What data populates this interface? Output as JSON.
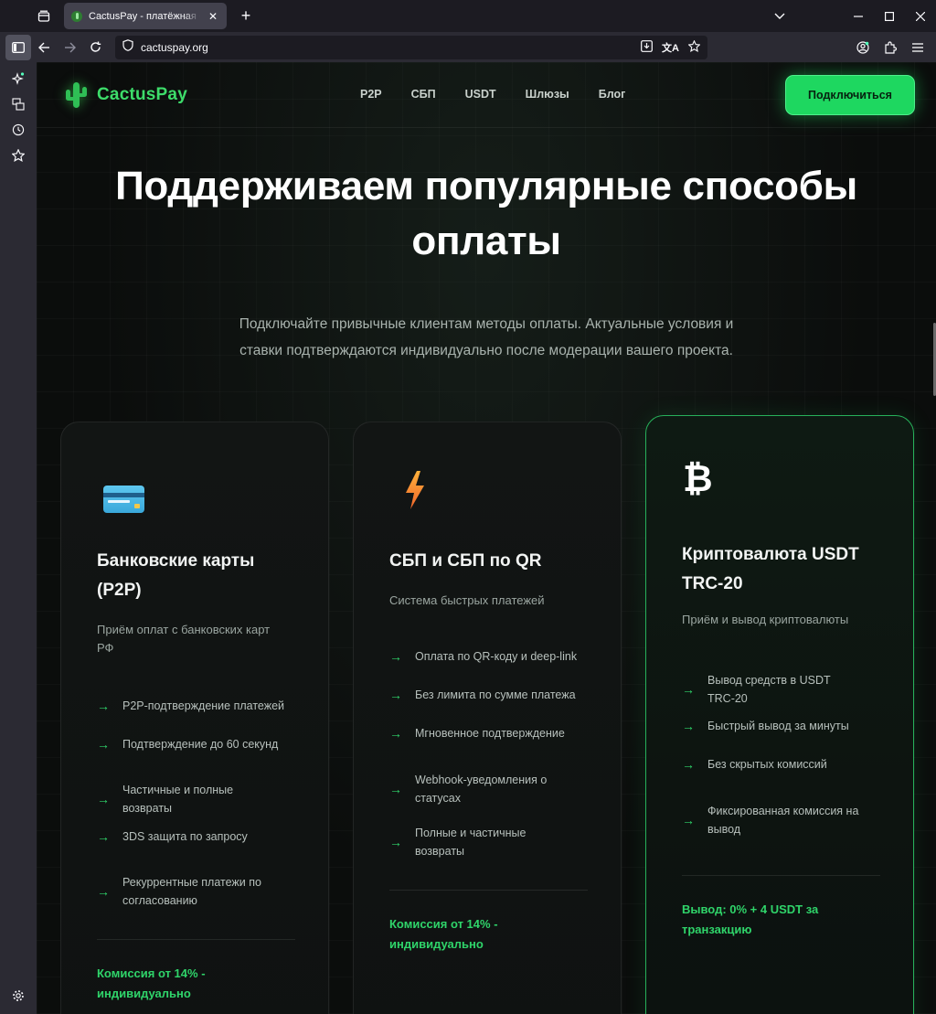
{
  "browser": {
    "tab_title": "CactusPay - платёжная система",
    "url": "cactuspay.org"
  },
  "site": {
    "logo": "CactusPay",
    "nav": [
      "P2P",
      "СБП",
      "USDT",
      "Шлюзы",
      "Блог"
    ],
    "connect_button": "Подключиться"
  },
  "hero": {
    "title_line1": "Поддерживаем популярные способы",
    "title_line2": "оплаты",
    "subtitle_line1": "Подключайте привычные клиентам методы оплаты. Актуальные условия и",
    "subtitle_line2": "ставки подтверждаются индивидуально после модерации вашего проекта."
  },
  "cards": [
    {
      "icon": "credit-card-icon",
      "title_line1": "Банковские карты",
      "title_line2": "(P2P)",
      "desc_line1": "Приём оплат с банковских карт",
      "desc_line2": "РФ",
      "features": [
        [
          "P2P-подтверждение платежей"
        ],
        [
          "Подтверждение до 60 секунд"
        ],
        [
          "Частичные и полные",
          "возвраты"
        ],
        [
          "3DS защита по запросу"
        ],
        [
          "Рекуррентные платежи по",
          "согласованию"
        ]
      ],
      "commission_line1": "Комиссия от 14% -",
      "commission_line2": "индивидуально"
    },
    {
      "icon": "lightning-icon",
      "title_line1": "СБП и СБП по QR",
      "desc_line1": "Система быстрых платежей",
      "features": [
        [
          "Оплата по QR-коду и deep-link"
        ],
        [
          "Без лимита по сумме платежа"
        ],
        [
          "Мгновенное подтверждение"
        ],
        [
          "Webhook-уведомления о",
          "статусах"
        ],
        [
          "Полные и частичные",
          "возвраты"
        ]
      ],
      "commission_line1": "Комиссия от 14% -",
      "commission_line2": "индивидуально"
    },
    {
      "icon": "bitcoin-icon",
      "title_line1": "Криптовалюта USDT",
      "title_line2": "TRC-20",
      "desc_line1": "Приём и вывод криптовалюты",
      "features": [
        [
          "Вывод средств в USDT",
          "TRC-20"
        ],
        [
          "Быстрый вывод за минуты"
        ],
        [
          "Без скрытых комиссий"
        ],
        [
          "Фиксированная комиссия на",
          "вывод"
        ]
      ],
      "commission_line1": "Вывод: 0% + 4 USDT за",
      "commission_line2": "транзакцию"
    }
  ],
  "icons": {
    "btc_glyph": "₿",
    "arrow_glyph": "→"
  },
  "colors": {
    "accent": "#1ed760",
    "page_bg": "#0b0d0c"
  }
}
